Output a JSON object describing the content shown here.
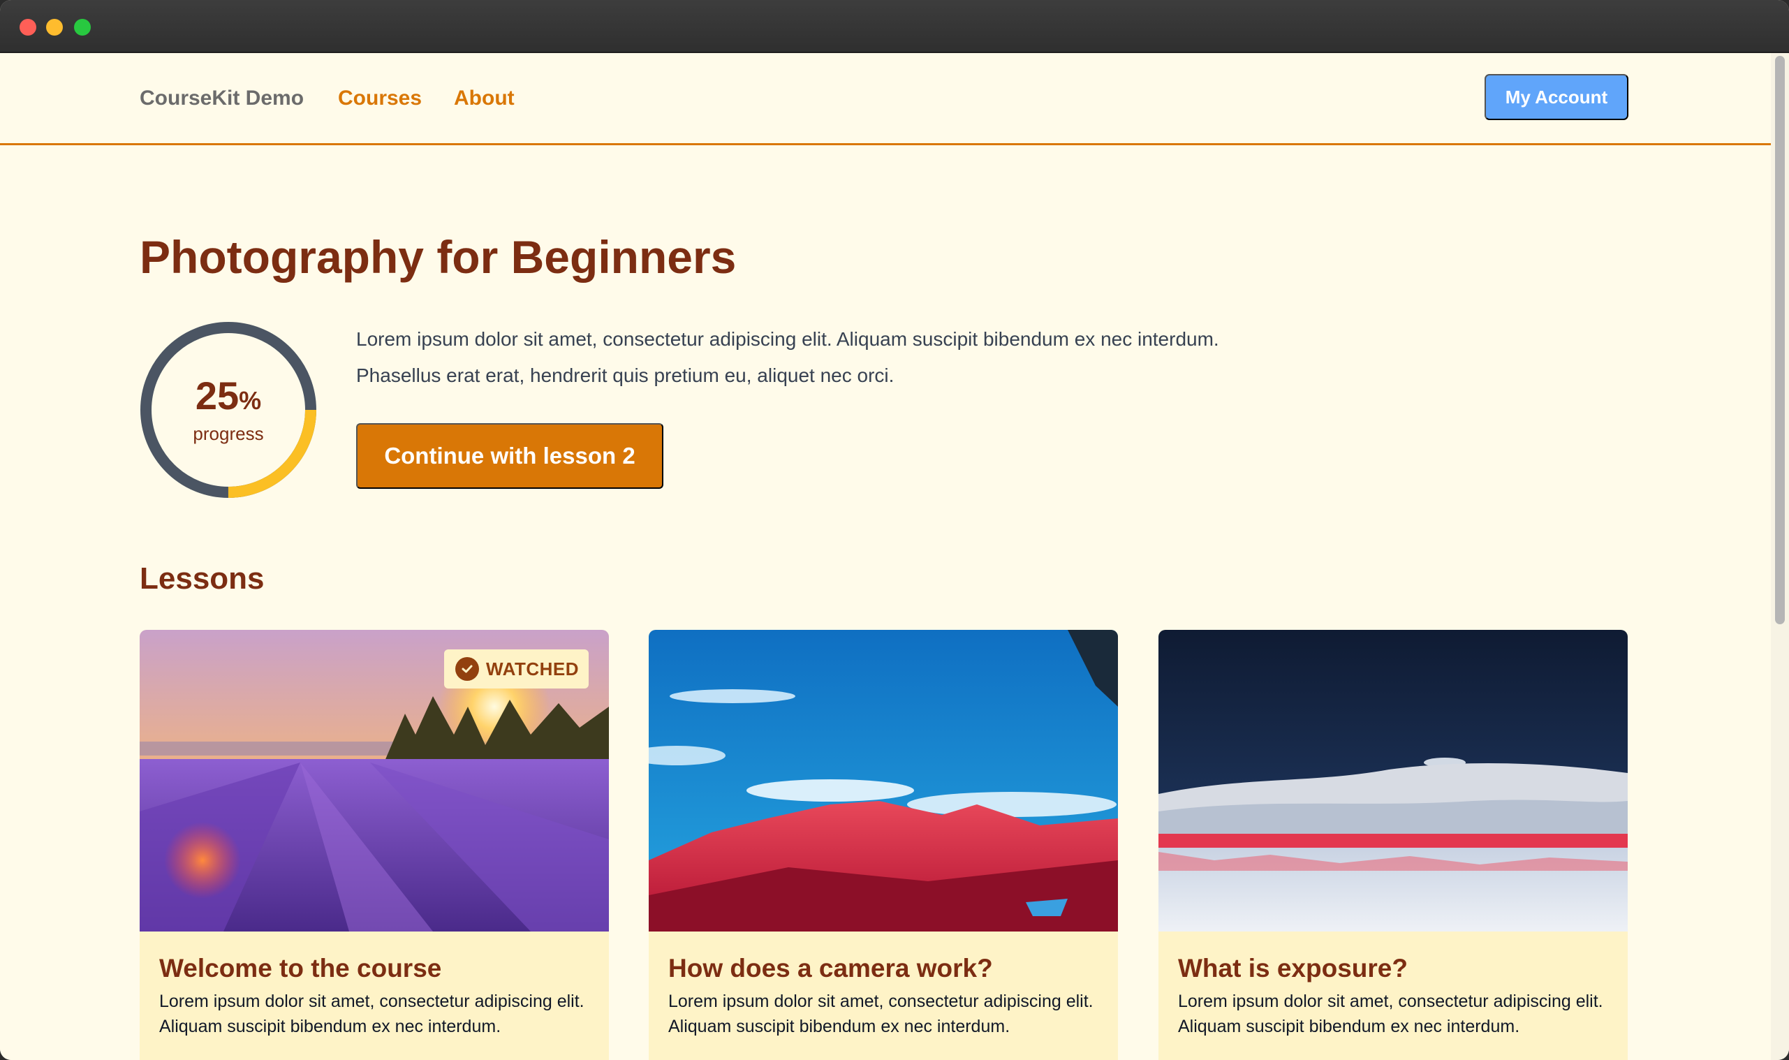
{
  "nav": {
    "brand": "CourseKit Demo",
    "links": [
      {
        "label": "Courses"
      },
      {
        "label": "About"
      }
    ],
    "account_label": "My Account"
  },
  "course": {
    "title": "Photography for Beginners",
    "progress": {
      "value": "25",
      "unit": "%",
      "label": "progress",
      "fraction": 0.25
    },
    "description": "Lorem ipsum dolor sit amet, consectetur adipiscing elit. Aliquam suscipit bibendum ex nec interdum. Phasellus erat erat, hendrerit quis pretium eu, aliquet nec orci.",
    "continue_label": "Continue with lesson 2"
  },
  "lessons": {
    "heading": "Lessons",
    "items": [
      {
        "title": "Welcome to the course",
        "text": "Lorem ipsum dolor sit amet, consectetur adipiscing elit. Aliquam suscipit bibendum ex nec interdum.",
        "badge": "WATCHED"
      },
      {
        "title": "How does a camera work?",
        "text": "Lorem ipsum dolor sit amet, consectetur adipiscing elit. Aliquam suscipit bibendum ex nec interdum."
      },
      {
        "title": "What is exposure?",
        "text": "Lorem ipsum dolor sit amet, consectetur adipiscing elit. Aliquam suscipit bibendum ex nec interdum."
      }
    ]
  },
  "colors": {
    "accent": "#d97706",
    "heading": "#7c2d12",
    "account_button": "#60a5fa",
    "progress_ring": "#fbbf24",
    "progress_track": "#4b5563"
  },
  "icons": [
    "check-circle-icon"
  ]
}
